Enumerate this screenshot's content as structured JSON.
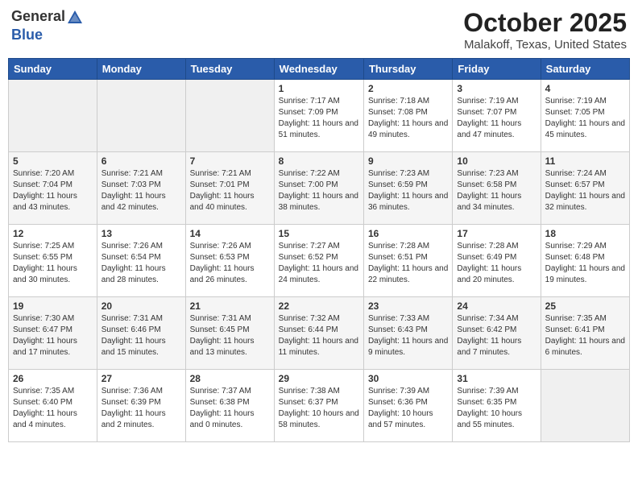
{
  "header": {
    "logo_general": "General",
    "logo_blue": "Blue",
    "title": "October 2025",
    "subtitle": "Malakoff, Texas, United States"
  },
  "weekdays": [
    "Sunday",
    "Monday",
    "Tuesday",
    "Wednesday",
    "Thursday",
    "Friday",
    "Saturday"
  ],
  "weeks": [
    [
      {
        "day": "",
        "sunrise": "",
        "sunset": "",
        "daylight": ""
      },
      {
        "day": "",
        "sunrise": "",
        "sunset": "",
        "daylight": ""
      },
      {
        "day": "",
        "sunrise": "",
        "sunset": "",
        "daylight": ""
      },
      {
        "day": "1",
        "sunrise": "Sunrise: 7:17 AM",
        "sunset": "Sunset: 7:09 PM",
        "daylight": "Daylight: 11 hours and 51 minutes."
      },
      {
        "day": "2",
        "sunrise": "Sunrise: 7:18 AM",
        "sunset": "Sunset: 7:08 PM",
        "daylight": "Daylight: 11 hours and 49 minutes."
      },
      {
        "day": "3",
        "sunrise": "Sunrise: 7:19 AM",
        "sunset": "Sunset: 7:07 PM",
        "daylight": "Daylight: 11 hours and 47 minutes."
      },
      {
        "day": "4",
        "sunrise": "Sunrise: 7:19 AM",
        "sunset": "Sunset: 7:05 PM",
        "daylight": "Daylight: 11 hours and 45 minutes."
      }
    ],
    [
      {
        "day": "5",
        "sunrise": "Sunrise: 7:20 AM",
        "sunset": "Sunset: 7:04 PM",
        "daylight": "Daylight: 11 hours and 43 minutes."
      },
      {
        "day": "6",
        "sunrise": "Sunrise: 7:21 AM",
        "sunset": "Sunset: 7:03 PM",
        "daylight": "Daylight: 11 hours and 42 minutes."
      },
      {
        "day": "7",
        "sunrise": "Sunrise: 7:21 AM",
        "sunset": "Sunset: 7:01 PM",
        "daylight": "Daylight: 11 hours and 40 minutes."
      },
      {
        "day": "8",
        "sunrise": "Sunrise: 7:22 AM",
        "sunset": "Sunset: 7:00 PM",
        "daylight": "Daylight: 11 hours and 38 minutes."
      },
      {
        "day": "9",
        "sunrise": "Sunrise: 7:23 AM",
        "sunset": "Sunset: 6:59 PM",
        "daylight": "Daylight: 11 hours and 36 minutes."
      },
      {
        "day": "10",
        "sunrise": "Sunrise: 7:23 AM",
        "sunset": "Sunset: 6:58 PM",
        "daylight": "Daylight: 11 hours and 34 minutes."
      },
      {
        "day": "11",
        "sunrise": "Sunrise: 7:24 AM",
        "sunset": "Sunset: 6:57 PM",
        "daylight": "Daylight: 11 hours and 32 minutes."
      }
    ],
    [
      {
        "day": "12",
        "sunrise": "Sunrise: 7:25 AM",
        "sunset": "Sunset: 6:55 PM",
        "daylight": "Daylight: 11 hours and 30 minutes."
      },
      {
        "day": "13",
        "sunrise": "Sunrise: 7:26 AM",
        "sunset": "Sunset: 6:54 PM",
        "daylight": "Daylight: 11 hours and 28 minutes."
      },
      {
        "day": "14",
        "sunrise": "Sunrise: 7:26 AM",
        "sunset": "Sunset: 6:53 PM",
        "daylight": "Daylight: 11 hours and 26 minutes."
      },
      {
        "day": "15",
        "sunrise": "Sunrise: 7:27 AM",
        "sunset": "Sunset: 6:52 PM",
        "daylight": "Daylight: 11 hours and 24 minutes."
      },
      {
        "day": "16",
        "sunrise": "Sunrise: 7:28 AM",
        "sunset": "Sunset: 6:51 PM",
        "daylight": "Daylight: 11 hours and 22 minutes."
      },
      {
        "day": "17",
        "sunrise": "Sunrise: 7:28 AM",
        "sunset": "Sunset: 6:49 PM",
        "daylight": "Daylight: 11 hours and 20 minutes."
      },
      {
        "day": "18",
        "sunrise": "Sunrise: 7:29 AM",
        "sunset": "Sunset: 6:48 PM",
        "daylight": "Daylight: 11 hours and 19 minutes."
      }
    ],
    [
      {
        "day": "19",
        "sunrise": "Sunrise: 7:30 AM",
        "sunset": "Sunset: 6:47 PM",
        "daylight": "Daylight: 11 hours and 17 minutes."
      },
      {
        "day": "20",
        "sunrise": "Sunrise: 7:31 AM",
        "sunset": "Sunset: 6:46 PM",
        "daylight": "Daylight: 11 hours and 15 minutes."
      },
      {
        "day": "21",
        "sunrise": "Sunrise: 7:31 AM",
        "sunset": "Sunset: 6:45 PM",
        "daylight": "Daylight: 11 hours and 13 minutes."
      },
      {
        "day": "22",
        "sunrise": "Sunrise: 7:32 AM",
        "sunset": "Sunset: 6:44 PM",
        "daylight": "Daylight: 11 hours and 11 minutes."
      },
      {
        "day": "23",
        "sunrise": "Sunrise: 7:33 AM",
        "sunset": "Sunset: 6:43 PM",
        "daylight": "Daylight: 11 hours and 9 minutes."
      },
      {
        "day": "24",
        "sunrise": "Sunrise: 7:34 AM",
        "sunset": "Sunset: 6:42 PM",
        "daylight": "Daylight: 11 hours and 7 minutes."
      },
      {
        "day": "25",
        "sunrise": "Sunrise: 7:35 AM",
        "sunset": "Sunset: 6:41 PM",
        "daylight": "Daylight: 11 hours and 6 minutes."
      }
    ],
    [
      {
        "day": "26",
        "sunrise": "Sunrise: 7:35 AM",
        "sunset": "Sunset: 6:40 PM",
        "daylight": "Daylight: 11 hours and 4 minutes."
      },
      {
        "day": "27",
        "sunrise": "Sunrise: 7:36 AM",
        "sunset": "Sunset: 6:39 PM",
        "daylight": "Daylight: 11 hours and 2 minutes."
      },
      {
        "day": "28",
        "sunrise": "Sunrise: 7:37 AM",
        "sunset": "Sunset: 6:38 PM",
        "daylight": "Daylight: 11 hours and 0 minutes."
      },
      {
        "day": "29",
        "sunrise": "Sunrise: 7:38 AM",
        "sunset": "Sunset: 6:37 PM",
        "daylight": "Daylight: 10 hours and 58 minutes."
      },
      {
        "day": "30",
        "sunrise": "Sunrise: 7:39 AM",
        "sunset": "Sunset: 6:36 PM",
        "daylight": "Daylight: 10 hours and 57 minutes."
      },
      {
        "day": "31",
        "sunrise": "Sunrise: 7:39 AM",
        "sunset": "Sunset: 6:35 PM",
        "daylight": "Daylight: 10 hours and 55 minutes."
      },
      {
        "day": "",
        "sunrise": "",
        "sunset": "",
        "daylight": ""
      }
    ]
  ]
}
